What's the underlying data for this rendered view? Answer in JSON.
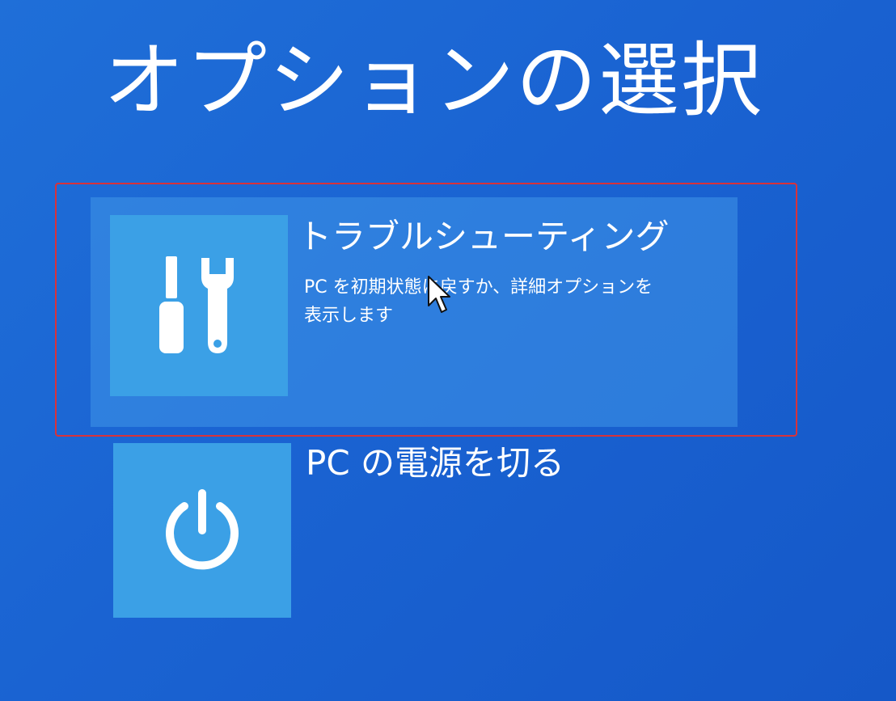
{
  "page": {
    "title": "オプションの選択"
  },
  "options": [
    {
      "icon": "tools-icon",
      "title": "トラブルシューティング",
      "description_lines": [
        "PC を初期状態に戻すか、詳細オプションを",
        "表示します"
      ],
      "focused": true
    },
    {
      "icon": "power-icon",
      "title": "PC の電源を切る",
      "description_lines": [],
      "focused": false
    }
  ],
  "colors": {
    "background": "#1a63d2",
    "tile": "#3ba0e6",
    "focus_frame": "#d8323a",
    "text": "#ffffff"
  }
}
